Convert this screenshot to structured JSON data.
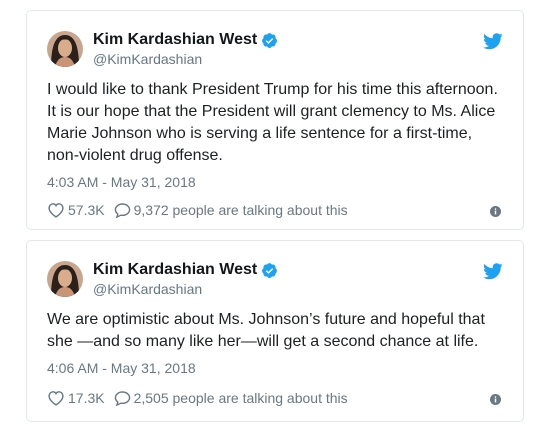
{
  "colors": {
    "twitter_blue": "#1da1f2",
    "text_primary": "#14171a",
    "text_secondary": "#697882",
    "border": "#e1e8ed"
  },
  "tweets": [
    {
      "author": {
        "display_name": "Kim Kardashian West",
        "handle": "@KimKardashian",
        "verified": true,
        "avatar_icon": "profile-photo"
      },
      "text": "I would like to thank President Trump for his time this afternoon. It is our hope that the President will grant clemency to Ms. Alice Marie Johnson who is serving a life sentence for a first-time, non-violent drug offense.",
      "timestamp": "4:03 AM - May 31, 2018",
      "likes": "57.3K",
      "talking": "9,372 people are talking about this"
    },
    {
      "author": {
        "display_name": "Kim Kardashian West",
        "handle": "@KimKardashian",
        "verified": true,
        "avatar_icon": "profile-photo"
      },
      "text": "We are optimistic about Ms. Johnson’s future and hopeful that she —and so many like her—will get a second chance at life.",
      "timestamp": "4:06 AM - May 31, 2018",
      "likes": "17.3K",
      "talking": "2,505 people are talking about this"
    }
  ]
}
